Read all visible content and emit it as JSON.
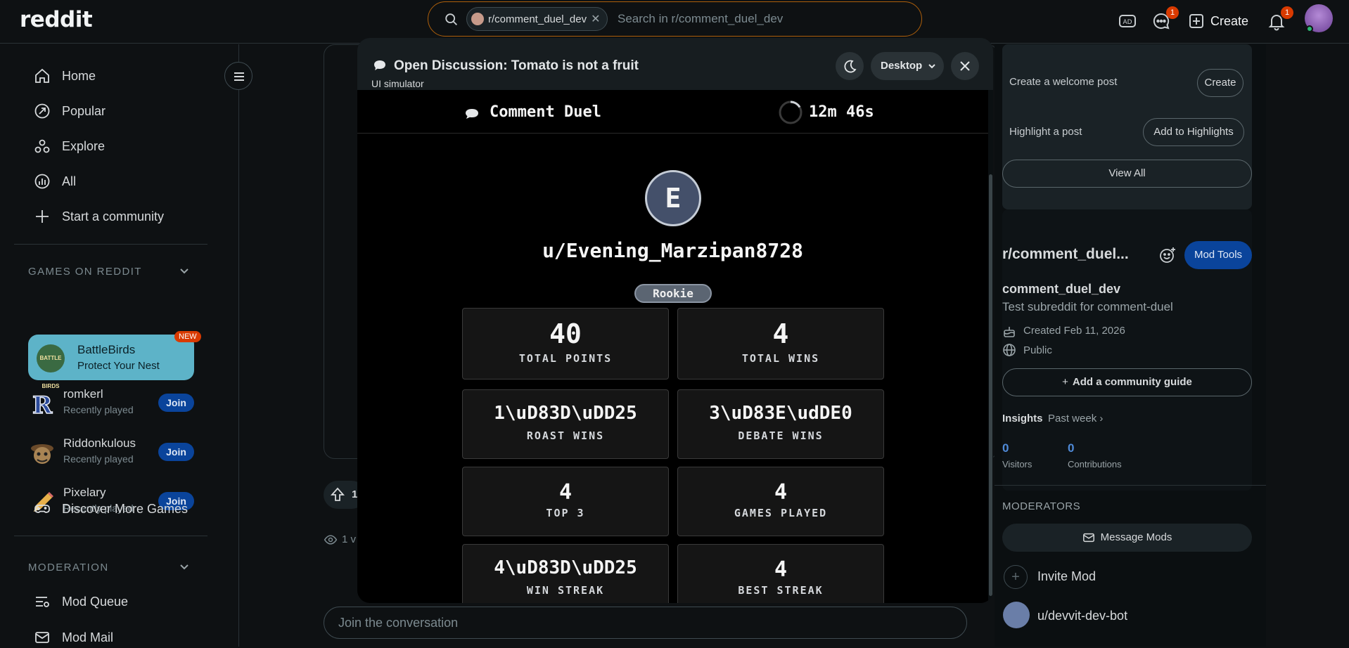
{
  "header": {
    "logo": "reddit",
    "search_chip": "r/comment_duel_dev",
    "search_placeholder": "Search in r/comment_duel_dev",
    "chat_badge": "1",
    "create_label": "Create",
    "notif_badge": "1"
  },
  "sidebar": {
    "nav": [
      {
        "label": "Home"
      },
      {
        "label": "Popular"
      },
      {
        "label": "Explore"
      },
      {
        "label": "All"
      },
      {
        "label": "Start a community"
      }
    ],
    "games_title": "GAMES ON REDDIT",
    "featured": {
      "name": "BattleBirds",
      "tagline": "Protect Your Nest",
      "badge": "NEW",
      "logo_text": "BATTLE BIRDS"
    },
    "games": [
      {
        "name": "romkerl",
        "sub": "Recently played",
        "action": "Join"
      },
      {
        "name": "Riddonkulous",
        "sub": "Recently played",
        "action": "Join"
      },
      {
        "name": "Pixelary",
        "sub": "Recently played",
        "action": "Join"
      }
    ],
    "discover": "Discover More Games",
    "moderation_title": "MODERATION",
    "mod_items": [
      {
        "label": "Mod Queue"
      },
      {
        "label": "Mod Mail"
      }
    ]
  },
  "post": {
    "vote_count": "1",
    "views": "1 v",
    "comment_placeholder": "Join the conversation"
  },
  "right": {
    "welcome_label": "Create a welcome post",
    "welcome_btn": "Create",
    "highlight_label": "Highlight a post",
    "highlight_btn": "Add to Highlights",
    "view_all": "View All",
    "community_title": "r/comment_duel...",
    "mod_tools": "Mod Tools",
    "community_name": "comment_duel_dev",
    "community_desc": "Test subreddit for comment-duel",
    "created": "Created Feb 11, 2026",
    "visibility": "Public",
    "guide_btn": "Add a community guide",
    "insights_label": "Insights",
    "insights_period": "Past week",
    "visitors_value": "0",
    "visitors_label": "Visitors",
    "contrib_value": "0",
    "contrib_label": "Contributions",
    "moderators_title": "MODERATORS",
    "message_mods": "Message Mods",
    "invite_mod": "Invite Mod",
    "mod_user": "u/devvit-dev-bot"
  },
  "modal": {
    "title": "Open Discussion: Tomato is not a fruit",
    "subtitle": "UI simulator",
    "device": "Desktop"
  },
  "game": {
    "app_name": "Comment Duel",
    "timer": "12m 46s",
    "avatar_letter": "E",
    "username": "u/Evening_Marzipan8728",
    "rank": "Rookie",
    "stats": [
      {
        "value": "40",
        "label": "TOTAL POINTS"
      },
      {
        "value": "4",
        "label": "TOTAL WINS"
      },
      {
        "value": "1\\uD83D\\uDD25",
        "label": "ROAST WINS"
      },
      {
        "value": "3\\uD83E\\udDE0",
        "label": "DEBATE WINS"
      },
      {
        "value": "4",
        "label": "TOP 3"
      },
      {
        "value": "4",
        "label": "GAMES PLAYED"
      },
      {
        "value": "4\\uD83D\\uDD25",
        "label": "WIN STREAK"
      },
      {
        "value": "4",
        "label": "BEST STREAK"
      }
    ]
  },
  "colors": {
    "accent_join": "#0a449b",
    "notif_badge": "#d93a00",
    "search_border": "#ad5f0b",
    "battlebirds": "#5db3c8"
  }
}
